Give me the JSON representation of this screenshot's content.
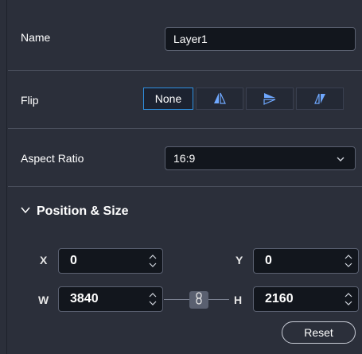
{
  "name": {
    "label": "Name",
    "value": "Layer1"
  },
  "flip": {
    "label": "Flip",
    "options": [
      {
        "label": "None",
        "icon": "none",
        "selected": true
      },
      {
        "label": "",
        "icon": "flip-horizontal-icon",
        "selected": false
      },
      {
        "label": "",
        "icon": "flip-vertical-icon",
        "selected": false
      },
      {
        "label": "",
        "icon": "flip-both-icon",
        "selected": false
      }
    ]
  },
  "aspect_ratio": {
    "label": "Aspect Ratio",
    "value": "16:9"
  },
  "position_size": {
    "title": "Position & Size",
    "x_label": "X",
    "x_value": "0",
    "y_label": "Y",
    "y_value": "0",
    "w_label": "W",
    "w_value": "3840",
    "h_label": "H",
    "h_value": "2160",
    "reset_label": "Reset"
  },
  "colors": {
    "background": "#2b2f3a",
    "input_bg": "#12161d",
    "accent": "#2e8fe0"
  }
}
